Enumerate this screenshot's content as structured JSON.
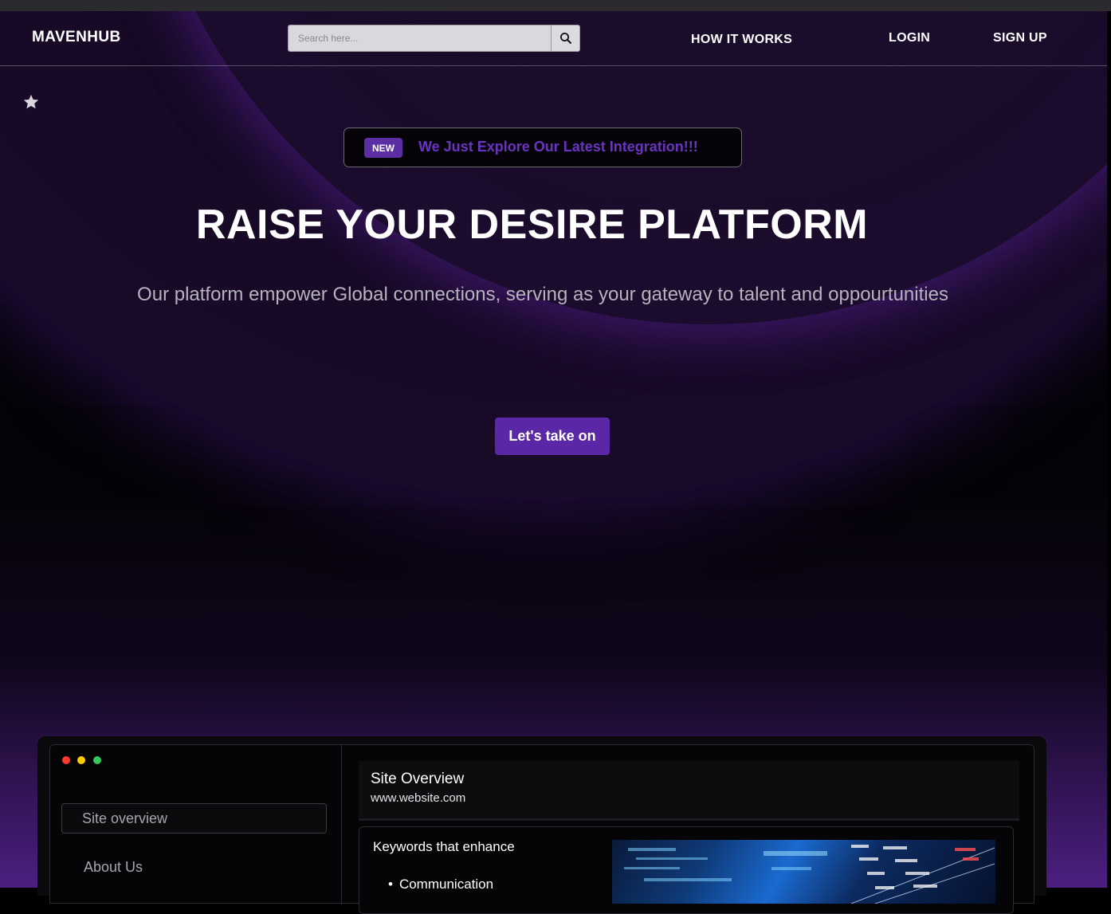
{
  "brand": {
    "name": "MAVENHUB"
  },
  "search": {
    "placeholder": "Search here..."
  },
  "nav": {
    "how_it_works": "HOW IT WORKS",
    "login": "LOGIN",
    "signup": "SIGN UP"
  },
  "announcement": {
    "badge": "NEW",
    "text": "We Just Explore Our Latest Integration!!!"
  },
  "hero": {
    "title": "RAISE YOUR DESIRE PLATFORM",
    "subtitle": "Our platform empower Global connections, serving as your gateway to talent and oppourtunities",
    "cta_label": "Let's take on"
  },
  "preview": {
    "sidebar": {
      "active_item": "Site overview",
      "items": [
        "About Us"
      ]
    },
    "site": {
      "title": "Site Overview",
      "url": "www.website.com"
    },
    "keywords": {
      "title": "Keywords that enhance",
      "items": [
        "Communication"
      ]
    }
  },
  "colors": {
    "accent": "#5a27a6",
    "badge_text": "#6a33c2",
    "background": "#050308"
  }
}
